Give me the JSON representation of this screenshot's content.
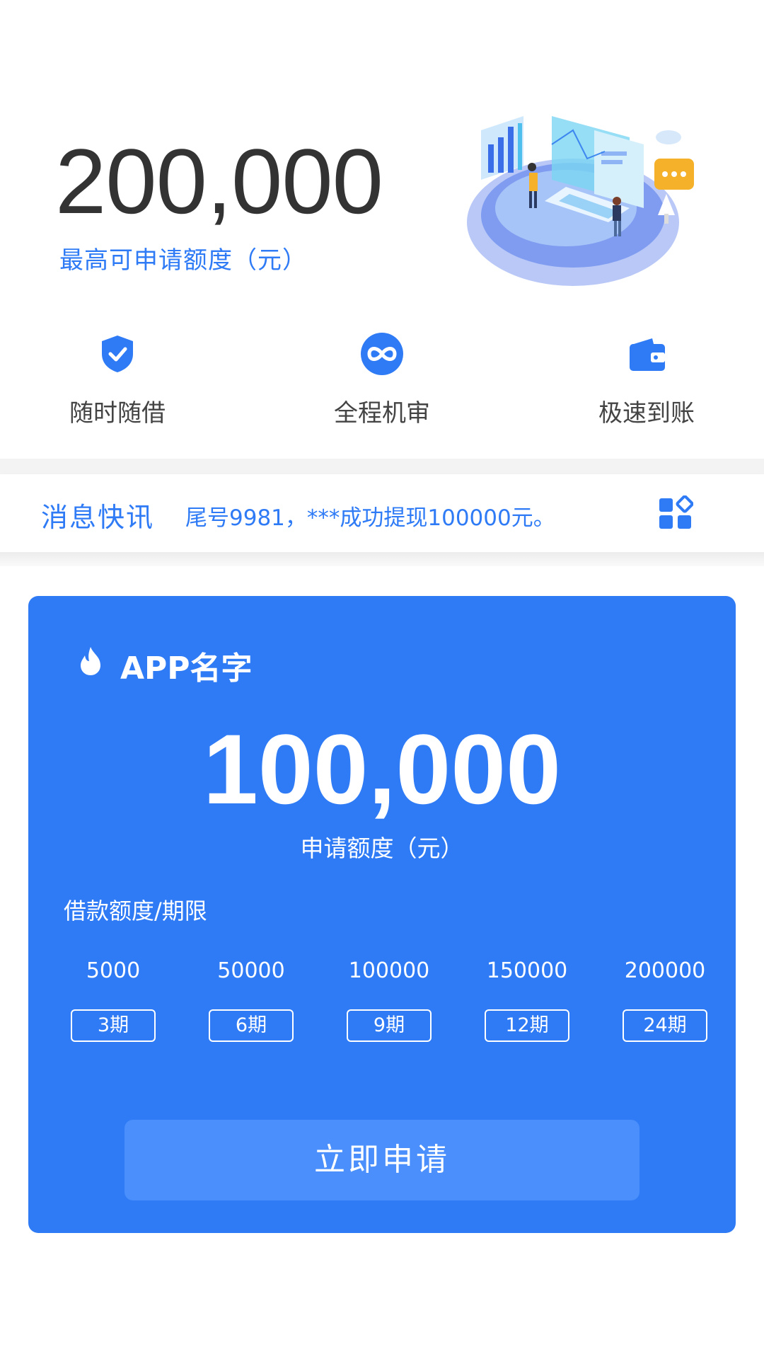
{
  "hero": {
    "max_amount": "200,000",
    "max_caption": "最高可申请额度（元）"
  },
  "features": [
    {
      "label": "随时随借",
      "icon": "shield-check-icon"
    },
    {
      "label": "全程机审",
      "icon": "infinity-icon"
    },
    {
      "label": "极速到账",
      "icon": "wallet-icon"
    }
  ],
  "news": {
    "title": "消息快讯",
    "text": "尾号9981，***成功提现100000元。",
    "icon": "apps-grid-icon"
  },
  "card": {
    "app_name": "APP名字",
    "icon": "flame-icon",
    "loan_amount": "100,000",
    "loan_caption": "申请额度（元）",
    "term_title": "借款额度/期限",
    "options": [
      {
        "amount": "5000",
        "term": "3期"
      },
      {
        "amount": "50000",
        "term": "6期"
      },
      {
        "amount": "100000",
        "term": "9期"
      },
      {
        "amount": "150000",
        "term": "12期"
      },
      {
        "amount": "200000",
        "term": "24期"
      }
    ],
    "apply_label": "立即申请"
  },
  "colors": {
    "accent": "#2f7bf6",
    "button": "#4a8ffb",
    "text_dark": "#333333",
    "background": "#ffffff"
  }
}
